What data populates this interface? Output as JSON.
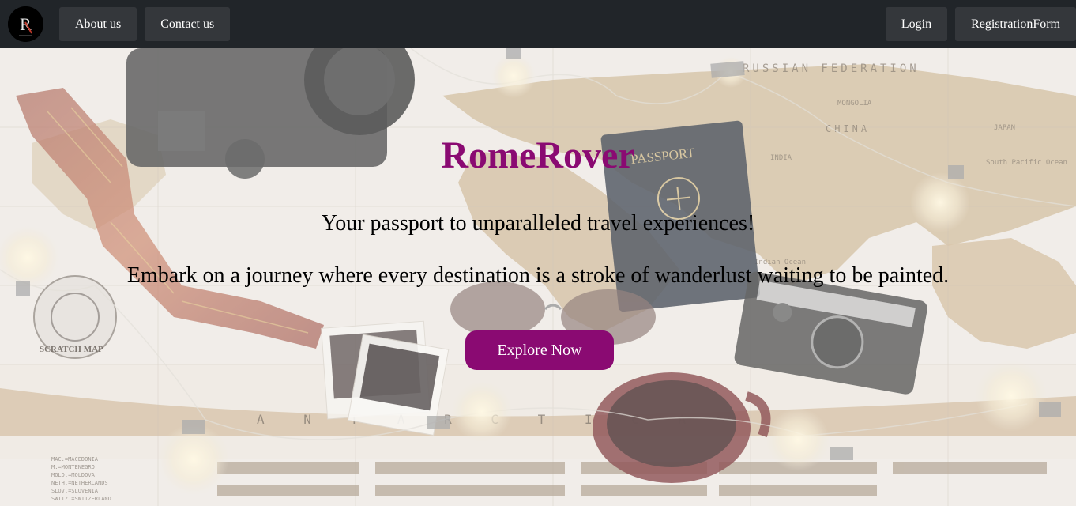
{
  "navbar": {
    "logo_letter": "R",
    "logo_icon": "brand-logo-icon",
    "left_links": [
      {
        "label": "About us"
      },
      {
        "label": "Contact us"
      }
    ],
    "right_links": [
      {
        "label": "Login"
      },
      {
        "label": "RegistrationForm"
      }
    ]
  },
  "hero": {
    "title": "RomeRover",
    "tagline": "Your passport to unparalleled travel experiences!",
    "subtitle": "Embark on a journey where every destination is a stroke of wanderlust waiting to be painted.",
    "cta_label": "Explore Now",
    "background_image": "travel-flatlay-map-passport-camera"
  },
  "map_text": {
    "russia": "RUSSIAN FEDERATION",
    "mongolia": "MONGOLIA",
    "china": "CHINA",
    "india": "INDIA",
    "japan": "JAPAN",
    "pacific": "South Pacific Ocean",
    "indian_ocean": "Indian Ocean",
    "antarctica": "A N T A R C T I C A",
    "passport": "PASSPORT",
    "scratch_map": "SCRATCH MAP"
  },
  "colors": {
    "navbar_bg": "#212529",
    "nav_button_bg": "#34373b",
    "accent": "#8a0a72"
  }
}
